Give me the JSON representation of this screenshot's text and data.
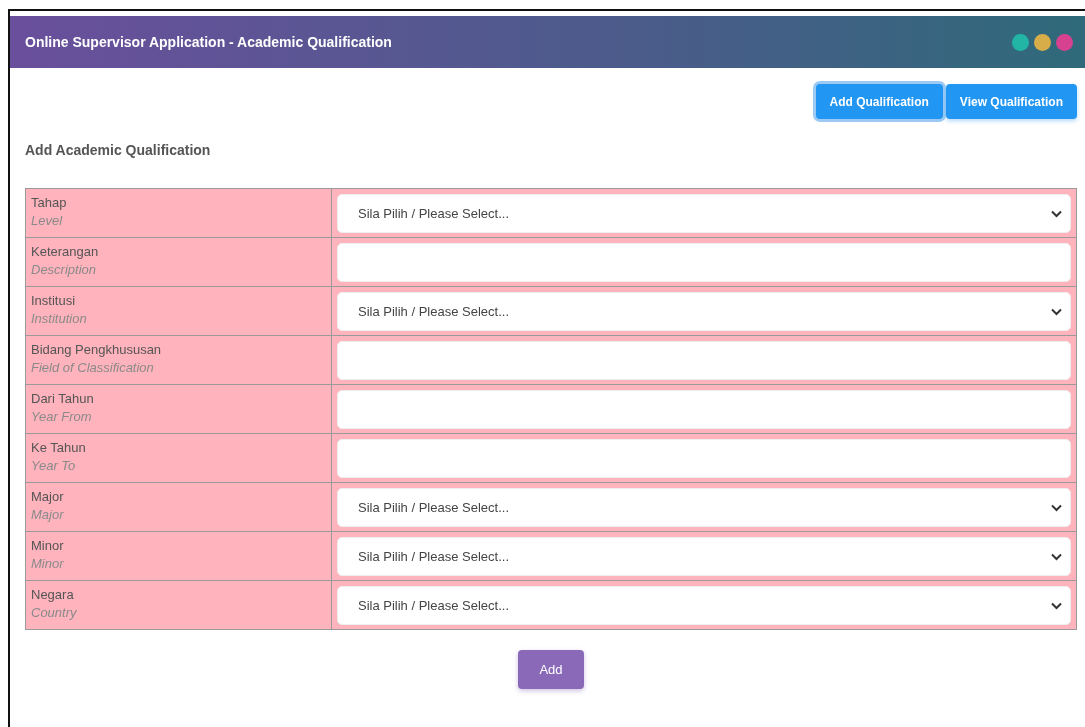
{
  "window": {
    "title": "Online Supervisor Application - Academic Qualification",
    "dots": [
      {
        "color": "#22b5a6"
      },
      {
        "color": "#d6ad48"
      },
      {
        "color": "#d6428f"
      }
    ]
  },
  "tabs": [
    {
      "label": "Add Qualification",
      "selected": true
    },
    {
      "label": "View Qualification",
      "selected": false
    }
  ],
  "heading": "Add Academic Qualification",
  "form_rows": [
    {
      "label": "Tahap",
      "sublabel": "Level",
      "kind": "select",
      "value": "Sila Pilih / Please Select..."
    },
    {
      "label": "Keterangan",
      "sublabel": "Description",
      "kind": "text"
    },
    {
      "label": "Institusi",
      "sublabel": "Institution",
      "kind": "select",
      "value": "Sila Pilih / Please Select..."
    },
    {
      "label": "Bidang Pengkhususan",
      "sublabel": "Field of Classification",
      "kind": "text"
    },
    {
      "label": "Dari Tahun",
      "sublabel": "Year From",
      "kind": "text"
    },
    {
      "label": "Ke Tahun",
      "sublabel": "Year To",
      "kind": "text"
    },
    {
      "label": "Major",
      "sublabel": "Major",
      "kind": "select",
      "value": "Sila Pilih / Please Select..."
    },
    {
      "label": "Minor",
      "sublabel": "Minor",
      "kind": "select",
      "value": "Sila Pilih / Please Select..."
    },
    {
      "label": "Negara",
      "sublabel": "Country",
      "kind": "select",
      "value": "Sila Pilih / Please Select..."
    }
  ],
  "submit": "Add"
}
